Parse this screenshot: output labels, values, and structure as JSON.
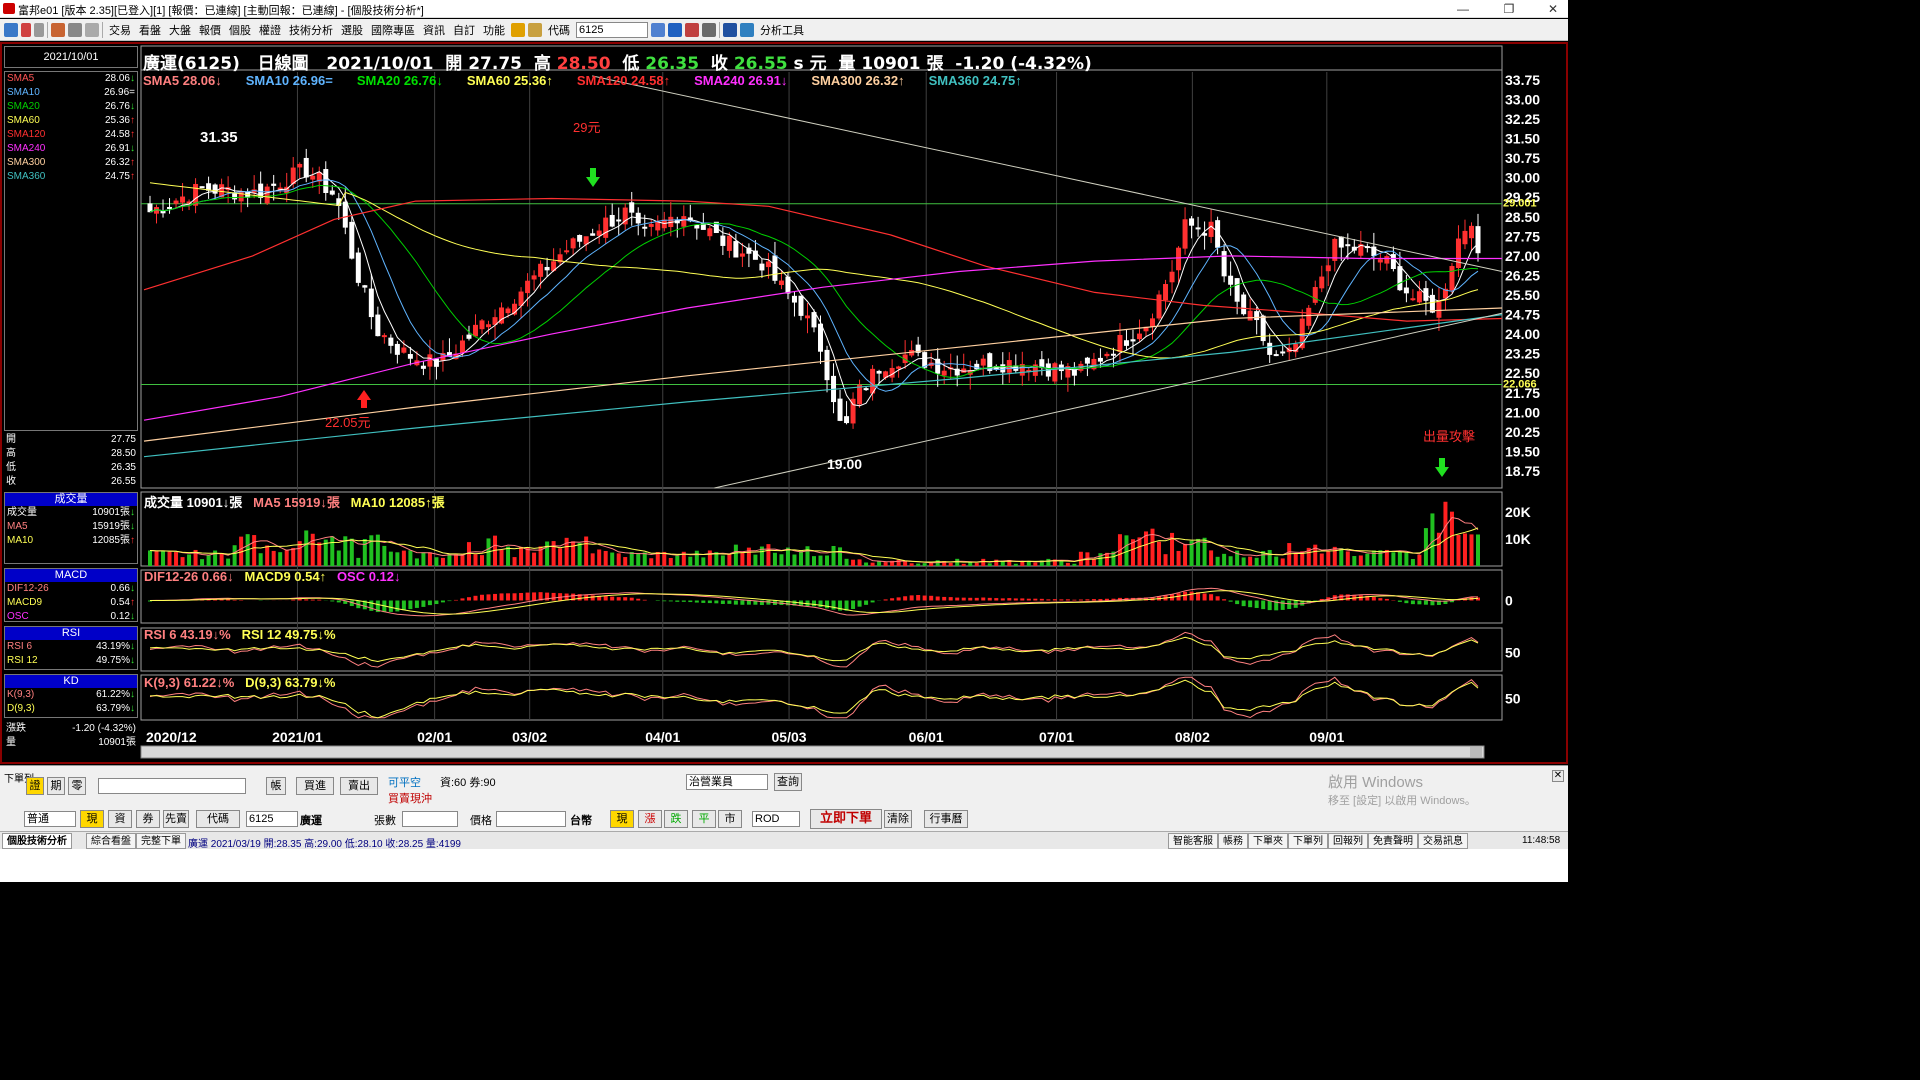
{
  "window": {
    "title": "富邦e01 [版本 2.35][已登入][1] [報價：已連線] [主動回報：已連線] - [個股技術分析*]"
  },
  "toolbar": {
    "menus": [
      "交易",
      "看盤",
      "大盤",
      "報價",
      "個股",
      "權證",
      "技術分析",
      "選股",
      "國際專區",
      "資訊",
      "自訂",
      "功能"
    ],
    "code_label": "代碼",
    "code_value": "6125",
    "tool_label": "分析工具"
  },
  "sidebar": {
    "date": "2021/10/01",
    "ma_list": [
      {
        "name": "SMA5",
        "value": "28.06",
        "arrow": "down",
        "color": "#ff5555"
      },
      {
        "name": "SMA10",
        "value": "26.96",
        "arrow": "eq",
        "color": "#5fb4ff"
      },
      {
        "name": "SMA20",
        "value": "26.76",
        "arrow": "down",
        "color": "#00d000"
      },
      {
        "name": "SMA60",
        "value": "25.36",
        "arrow": "up",
        "color": "#ffff55"
      },
      {
        "name": "SMA120",
        "value": "24.58",
        "arrow": "up",
        "color": "#ff3030"
      },
      {
        "name": "SMA240",
        "value": "26.91",
        "arrow": "down",
        "color": "#ff30ff"
      },
      {
        "name": "SMA300",
        "value": "26.32",
        "arrow": "up",
        "color": "#ffd0a0"
      },
      {
        "name": "SMA360",
        "value": "24.75",
        "arrow": "up",
        "color": "#40c0c0"
      }
    ],
    "ohlc": [
      {
        "label": "開",
        "value": "27.75"
      },
      {
        "label": "高",
        "value": "28.50"
      },
      {
        "label": "低",
        "value": "26.35"
      },
      {
        "label": "收",
        "value": "26.55"
      }
    ],
    "volume": {
      "title": "成交量",
      "rows": [
        {
          "label": "成交量",
          "value": "10901張",
          "arrow": "down",
          "color": "#ffffff"
        },
        {
          "label": "MA5",
          "value": "15919張",
          "arrow": "down",
          "color": "#ff8080"
        },
        {
          "label": "MA10",
          "value": "12085張",
          "arrow": "up",
          "color": "#ffff55"
        }
      ]
    },
    "macd": {
      "title": "MACD",
      "rows": [
        {
          "label": "DIF12-26",
          "value": "0.66",
          "arrow": "down",
          "color": "#ff8080"
        },
        {
          "label": "MACD9",
          "value": "0.54",
          "arrow": "up",
          "color": "#ffff55"
        },
        {
          "label": "OSC",
          "value": "0.12",
          "arrow": "down",
          "color": "#ff30ff"
        }
      ]
    },
    "rsi": {
      "title": "RSI",
      "rows": [
        {
          "label": "RSI 6",
          "value": "43.19%",
          "arrow": "down",
          "color": "#ff8080"
        },
        {
          "label": "RSI 12",
          "value": "49.75%",
          "arrow": "down",
          "color": "#ffff55"
        }
      ]
    },
    "kd": {
      "title": "KD",
      "rows": [
        {
          "label": "K(9,3)",
          "value": "61.22%",
          "arrow": "down",
          "color": "#ff8080"
        },
        {
          "label": "D(9,3)",
          "value": "63.79%",
          "arrow": "down",
          "color": "#ffff55"
        }
      ]
    },
    "change": {
      "label": "漲跌",
      "value": "-1.20 (-4.32%)"
    },
    "vol_total": {
      "label": "量",
      "value": "10901張"
    }
  },
  "header": {
    "name": "廣運(6125)",
    "chart_type": "日線圖",
    "date": "2021/10/01",
    "open_label": "開",
    "open": "27.75",
    "high_label": "高",
    "high": "28.50",
    "low_label": "低",
    "low": "26.35",
    "close_label": "收",
    "close": "26.55",
    "close_suffix": "s 元",
    "vol_label": "量",
    "vol": "10901",
    "vol_unit": "張",
    "change": "-1.20 (-4.32%)"
  },
  "ma_legend": [
    {
      "text": "SMA5 28.06↓",
      "color": "#ff8080"
    },
    {
      "text": "SMA10 26.96=",
      "color": "#5fb4ff"
    },
    {
      "text": "SMA20 26.76↓",
      "color": "#00e000"
    },
    {
      "text": "SMA60 25.36↑",
      "color": "#ffff55"
    },
    {
      "text": "SMA120 24.58↑",
      "color": "#ff3030"
    },
    {
      "text": "SMA240 26.91↓",
      "color": "#ff30ff"
    },
    {
      "text": "SMA300 26.32↑",
      "color": "#ffd0a0"
    },
    {
      "text": "SMA360 24.75↑",
      "color": "#40c0c0"
    }
  ],
  "annotations": {
    "high_label": "31.35",
    "low_label": "19.00",
    "up_label": "22.05元",
    "down_label": "29元",
    "attack_label": "出量攻擊",
    "line_a": "29.001",
    "line_b": "22.066"
  },
  "price_axis": [
    "33.75",
    "33.00",
    "32.25",
    "31.50",
    "30.75",
    "30.00",
    "29.25",
    "28.50",
    "27.75",
    "27.00",
    "26.25",
    "25.50",
    "24.75",
    "24.00",
    "23.25",
    "22.50",
    "21.75",
    "21.00",
    "20.25",
    "19.50",
    "18.75"
  ],
  "date_axis": [
    {
      "label": "2020/12",
      "t": 0.0
    },
    {
      "label": "2021/01",
      "t": 0.113
    },
    {
      "label": "02/01",
      "t": 0.214
    },
    {
      "label": "03/02",
      "t": 0.284
    },
    {
      "label": "04/01",
      "t": 0.382
    },
    {
      "label": "05/03",
      "t": 0.475
    },
    {
      "label": "06/01",
      "t": 0.576
    },
    {
      "label": "07/01",
      "t": 0.672
    },
    {
      "label": "08/02",
      "t": 0.772
    },
    {
      "label": "09/01",
      "t": 0.871
    }
  ],
  "volume_panel": {
    "title": "成交量 10901↓張",
    "ma5": "MA5 15919↓張",
    "ma10": "MA10 12085↑張",
    "axis": [
      "20K",
      "10K"
    ]
  },
  "macd_panel": {
    "dif": "DIF12-26 0.66↓",
    "macd": "MACD9 0.54↑",
    "osc": "OSC 0.12↓",
    "axis": "0"
  },
  "rsi_panel": {
    "rsi6": "RSI 6 43.19↓%",
    "rsi12": "RSI 12 49.75↓%",
    "axis": "50"
  },
  "kd_panel": {
    "k": "K(9,3) 61.22↓%",
    "d": "D(9,3) 63.79↓%",
    "axis": "50"
  },
  "order": {
    "side_label": "下單列",
    "tabs": [
      "證",
      "期",
      "零"
    ],
    "account_placeholder": "",
    "buy_label": "買進",
    "sell_label": "賣出",
    "avail_label": "可平空",
    "credit_label": "資:60 券:90",
    "daytrade_label": "買賣現沖",
    "broker": "治營業員",
    "query_label": "查詢",
    "type": "普通",
    "spot_label": "現",
    "margin_label": "資",
    "short_label": "券",
    "firstsell_label": "先賣",
    "code_btn": "代碼",
    "code": "6125",
    "name": "廣運",
    "qty_label": "張數",
    "price_label": "價格",
    "currency": "台幣",
    "price_btns": [
      "現",
      "漲",
      "跌",
      "平",
      "市"
    ],
    "tif": "ROD",
    "submit_label": "立即下單",
    "clear_label": "清除",
    "calendar_label": "行事曆"
  },
  "status": {
    "tabs": [
      "個股技術分析",
      "綜合看盤",
      "完整下單"
    ],
    "quote": "廣運 2021/03/19 開:28.35 高:29.00 低:28.10 收:28.25 量:4199",
    "right_tabs": [
      "智能客服",
      "帳務",
      "下單夾",
      "下單列",
      "回報列",
      "免責聲明",
      "交易訊息"
    ],
    "time": "11:48:58"
  },
  "watermark": {
    "line1": "啟用 Windows",
    "line2": "移至 [設定] 以啟用 Windows。"
  }
}
